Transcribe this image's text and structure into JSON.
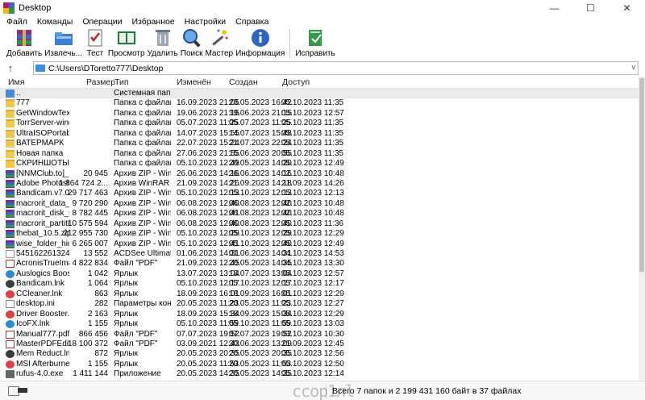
{
  "window": {
    "title": "Desktop",
    "minimize": "—",
    "maximize": "☐",
    "close": "✕"
  },
  "menu": [
    "Файл",
    "Команды",
    "Операции",
    "Избранное",
    "Настройки",
    "Справка"
  ],
  "toolbar": [
    "Добавить",
    "Извлечь...",
    "Тест",
    "Просмотр",
    "Удалить",
    "Поиск",
    "Мастер",
    "Информация",
    "Исправить"
  ],
  "address": {
    "path": "C:\\Users\\DToretto777\\Desktop",
    "up": "↑",
    "drop": "v"
  },
  "columns": {
    "name": "Имя",
    "size": "Размер",
    "type": "Тип",
    "modified": "Изменён",
    "created": "Создан",
    "accessed": "Доступ",
    "sort": "^"
  },
  "files": [
    {
      "name": "..",
      "size": "",
      "type": "Системная папка",
      "modified": "",
      "created": "",
      "accessed": "",
      "icon": "up"
    },
    {
      "name": "777",
      "size": "",
      "type": "Папка с файлами",
      "modified": "16.09.2023 21:05",
      "created": "23.05.2023 16:42",
      "accessed": "05.10.2023 11:35",
      "icon": "folder"
    },
    {
      "name": "GetWindowText ...",
      "size": "",
      "type": "Папка с файлами",
      "modified": "19.06.2023 21:15",
      "created": "19.06.2023 21:15",
      "accessed": "05.10.2023 12:57",
      "icon": "folder"
    },
    {
      "name": "TorrServer-wind...",
      "size": "",
      "type": "Папка с файлами",
      "modified": "05.07.2023 11:25",
      "created": "05.07.2023 11:25",
      "accessed": "05.10.2023 11:35",
      "icon": "folder"
    },
    {
      "name": "UltraISOPortable...",
      "size": "",
      "type": "Папка с файлами",
      "modified": "14.07.2023 15:55",
      "created": "14.07.2023 15:48",
      "accessed": "05.10.2023 11:35",
      "icon": "folder"
    },
    {
      "name": "ВАТЕРМАРК",
      "size": "",
      "type": "Папка с файлами",
      "modified": "22.07.2023 15:24",
      "created": "21.07.2023 22:24",
      "accessed": "05.10.2023 11:35",
      "icon": "folder"
    },
    {
      "name": "Новая папка",
      "size": "",
      "type": "Папка с файлами",
      "modified": "27.06.2023 21:55",
      "created": "15.06.2023 20:55",
      "accessed": "05.10.2023 11:35",
      "icon": "folder"
    },
    {
      "name": "СКРИНШОТЫ",
      "size": "",
      "type": "Папка с файлами",
      "modified": "05.10.2023 12:49",
      "created": "20.05.2023 14:20",
      "accessed": "05.10.2023 12:49",
      "icon": "folder"
    },
    {
      "name": "[NNMClub.to]_...",
      "size": "20 945",
      "type": "Архив ZIP - WinRAR",
      "modified": "26.06.2023 14:16",
      "created": "26.06.2023 14:16",
      "accessed": "02.10.2023 10:48",
      "icon": "rar"
    },
    {
      "name": "Adobe Photosh...",
      "size": "1 864 724 2...",
      "type": "Архив WinRAR",
      "modified": "21.09.2023 14:26",
      "created": "21.09.2023 14:18",
      "accessed": "21.09.2023 14:26",
      "icon": "rar"
    },
    {
      "name": "Bandicam.v7.0.0...",
      "size": "29 717 463",
      "type": "Архив ZIP - WinRAR",
      "modified": "05.10.2023 12:13",
      "created": "05.10.2023 12:13",
      "accessed": "05.10.2023 12:13",
      "icon": "rar"
    },
    {
      "name": "macrorit_data_w...",
      "size": "9 720 290",
      "type": "Архив ZIP - WinRAR",
      "modified": "06.08.2023 12:40",
      "created": "06.08.2023 12:40",
      "accessed": "02.10.2023 10:48",
      "icon": "rar"
    },
    {
      "name": "macrorit_disk_sc...",
      "size": "8 782 445",
      "type": "Архив ZIP - WinRAR",
      "modified": "06.08.2023 12:41",
      "created": "06.08.2023 12:40",
      "accessed": "02.10.2023 10:48",
      "icon": "rar"
    },
    {
      "name": "macrorit_partiti...",
      "size": "10 575 594",
      "type": "Архив ZIP - WinRAR",
      "modified": "06.08.2023 12:40",
      "created": "06.08.2023 12:40",
      "accessed": "05.10.2023 11:36",
      "icon": "rar"
    },
    {
      "name": "thebat_10.5.zip",
      "size": "212 955 730",
      "type": "Архив ZIP - WinRAR",
      "modified": "05.10.2023 12:29",
      "created": "05.10.2023 12:29",
      "accessed": "05.10.2023 12:29",
      "icon": "rar"
    },
    {
      "name": "wise_folder_hide...",
      "size": "6 265 007",
      "type": "Архив ZIP - WinRAR",
      "modified": "05.10.2023 12:41",
      "created": "05.10.2023 12:40",
      "accessed": "05.10.2023 12:49",
      "icon": "rar"
    },
    {
      "name": "54516226132457...",
      "size": "13 552",
      "type": "ACDSee Ultimate 2...",
      "modified": "01.06.2023 14:31",
      "created": "01.06.2023 14:31",
      "accessed": "04.10.2023 14:53",
      "icon": "doc"
    },
    {
      "name": "AcronisTrueIma...",
      "size": "4 822 834",
      "type": "Файл \"PDF\"",
      "modified": "21.09.2023 12:45",
      "created": "20.05.2023 14:35",
      "accessed": "04.10.2023 13:30",
      "icon": "pdf"
    },
    {
      "name": "Auslogics Boost...",
      "size": "1 042",
      "type": "Ярлык",
      "modified": "13.07.2023 13:04",
      "created": "13.07.2023 13:04",
      "accessed": "05.10.2023 12:57",
      "icon": "lnk2"
    },
    {
      "name": "Bandicam.lnk",
      "size": "1 064",
      "type": "Ярлык",
      "modified": "05.10.2023 12:17",
      "created": "05.10.2023 12:17",
      "accessed": "05.10.2023 12:17",
      "icon": "lnk3"
    },
    {
      "name": "CCleaner.lnk",
      "size": "863",
      "type": "Ярлык",
      "modified": "18.09.2023 16:01",
      "created": "18.09.2023 16:01",
      "accessed": "05.10.2023 12:29",
      "icon": "lnk"
    },
    {
      "name": "desktop.ini",
      "size": "282",
      "type": "Параметры конф...",
      "modified": "20.05.2023 11:23",
      "created": "20.05.2023 11:23",
      "accessed": "05.10.2023 12:27",
      "icon": "ini"
    },
    {
      "name": "Driver Booster.lnk",
      "size": "2 163",
      "type": "Ярлык",
      "modified": "18.09.2023 15:34",
      "created": "18.09.2023 15:34",
      "accessed": "05.10.2023 12:29",
      "icon": "lnk"
    },
    {
      "name": "IcoFX.lnk",
      "size": "1 155",
      "type": "Ярлык",
      "modified": "05.10.2023 11:59",
      "created": "05.10.2023 11:59",
      "accessed": "05.10.2023 13:03",
      "icon": "lnk2"
    },
    {
      "name": "Manual777.pdf",
      "size": "866 456",
      "type": "Файл \"PDF\"",
      "modified": "07.07.2023 19:52",
      "created": "07.07.2023 19:52",
      "accessed": "03.10.2023 10:30",
      "icon": "pdf"
    },
    {
      "name": "MasterPDFEdito...",
      "size": "18 100 372",
      "type": "Файл \"PDF\"",
      "modified": "03.09.2021 12:43",
      "created": "30.06.2023 13:09",
      "accessed": "21.09.2023 12:45",
      "icon": "pdf"
    },
    {
      "name": "Mem Reduct.lnk",
      "size": "872",
      "type": "Ярлык",
      "modified": "20.05.2023 20:35",
      "created": "20.05.2023 20:35",
      "accessed": "05.10.2023 12:56",
      "icon": "lnk3"
    },
    {
      "name": "MSI Afterburner....",
      "size": "1 155",
      "type": "Ярлык",
      "modified": "20.05.2023 11:53",
      "created": "20.05.2023 11:53",
      "accessed": "05.10.2023 12:50",
      "icon": "lnk"
    },
    {
      "name": "rufus-4.0.exe",
      "size": "1 411 144",
      "type": "Приложение",
      "modified": "20.05.2023 14:35",
      "created": "20.05.2023 14:35",
      "accessed": "05.10.2023 12:14",
      "icon": "exe"
    }
  ],
  "status": {
    "text": "Всего 7 папок и 2 199 431 160 байт в 37 файлах",
    "watermark": "ccop1лl"
  }
}
